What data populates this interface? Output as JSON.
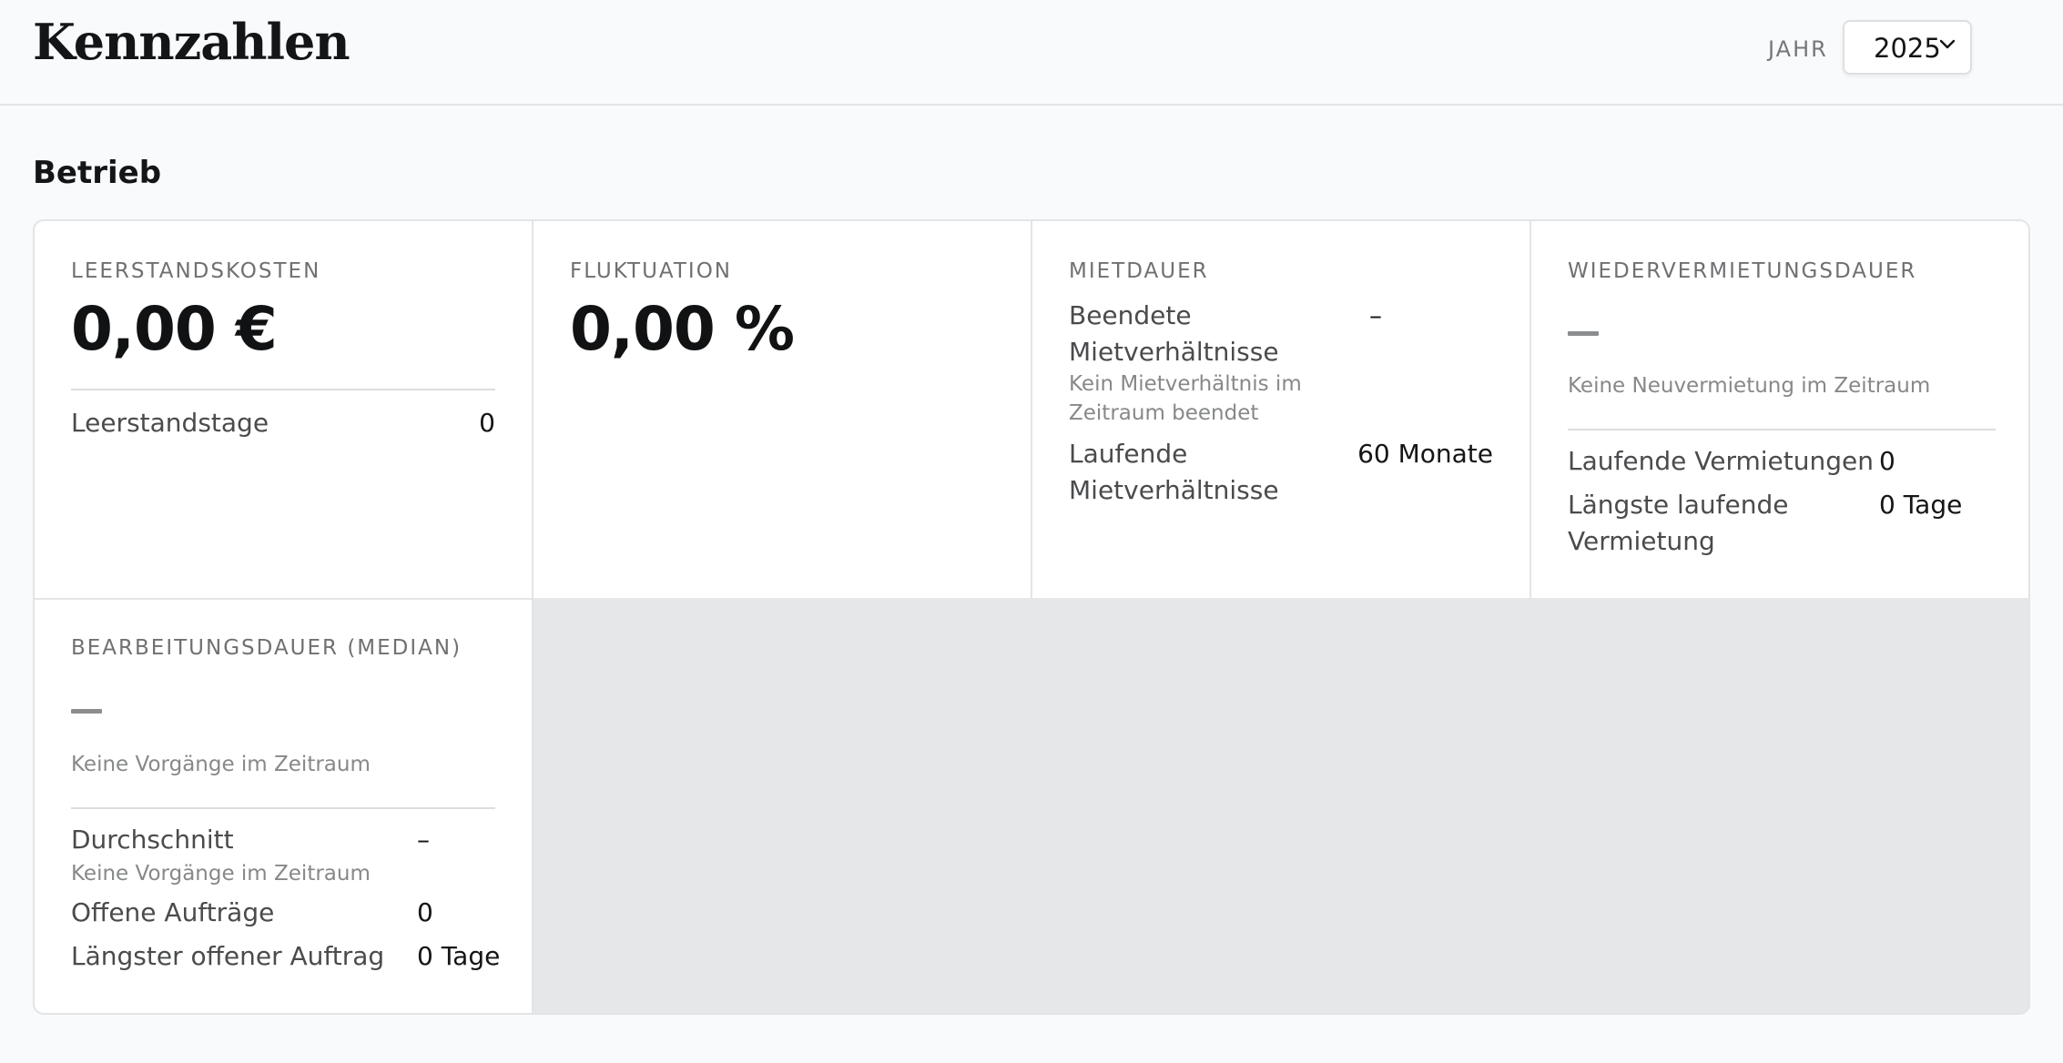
{
  "header": {
    "title": "Kennzahlen",
    "year_label": "JAHR",
    "year_value": "2025",
    "year_icon": "chevron-down-icon"
  },
  "section": {
    "title": "Betrieb"
  },
  "cards": {
    "leerstandskosten": {
      "label": "LEERSTANDSKOSTEN",
      "value": "0,00 €",
      "rows": [
        {
          "label": "Leerstandstage",
          "value": "0"
        }
      ]
    },
    "fluktuation": {
      "label": "FLUKTUATION",
      "value": "0,00 %"
    },
    "mietdauer": {
      "label": "MIETDAUER",
      "ended_label_1": "Beendete",
      "ended_label_2": "Mietverhältnisse",
      "ended_value": "–",
      "ended_note_1": "Kein Mietverhältnis im",
      "ended_note_2": "Zeitraum beendet",
      "running_label_1": "Laufende",
      "running_label_2": "Mietverhältnisse",
      "running_value": "60 Monate"
    },
    "wiedervermietungsdauer": {
      "label": "WIEDERVERMIETUNGSDAUER",
      "note": "Keine Neuvermietung im Zeitraum",
      "running_label": "Laufende Vermietungen",
      "running_value": "0",
      "longest_label_1": "Längste laufende",
      "longest_label_2": "Vermietung",
      "longest_value": "0 Tage"
    },
    "bearbeitungsdauer": {
      "label": "BEARBEITUNGSDAUER (MEDIAN)",
      "note": "Keine Vorgänge im Zeitraum",
      "avg_label": "Durchschnitt",
      "avg_value": "–",
      "avg_note": "Keine Vorgänge im Zeitraum",
      "open_label": "Offene Aufträge",
      "open_value": "0",
      "longest_label": "Längster offener Auftrag",
      "longest_value": "0 Tage"
    }
  },
  "colors": {
    "background": "#f9fafb",
    "card": "#ffffff",
    "empty_area": "#e6e7e8",
    "text": "#141516",
    "muted": "#87888a"
  }
}
